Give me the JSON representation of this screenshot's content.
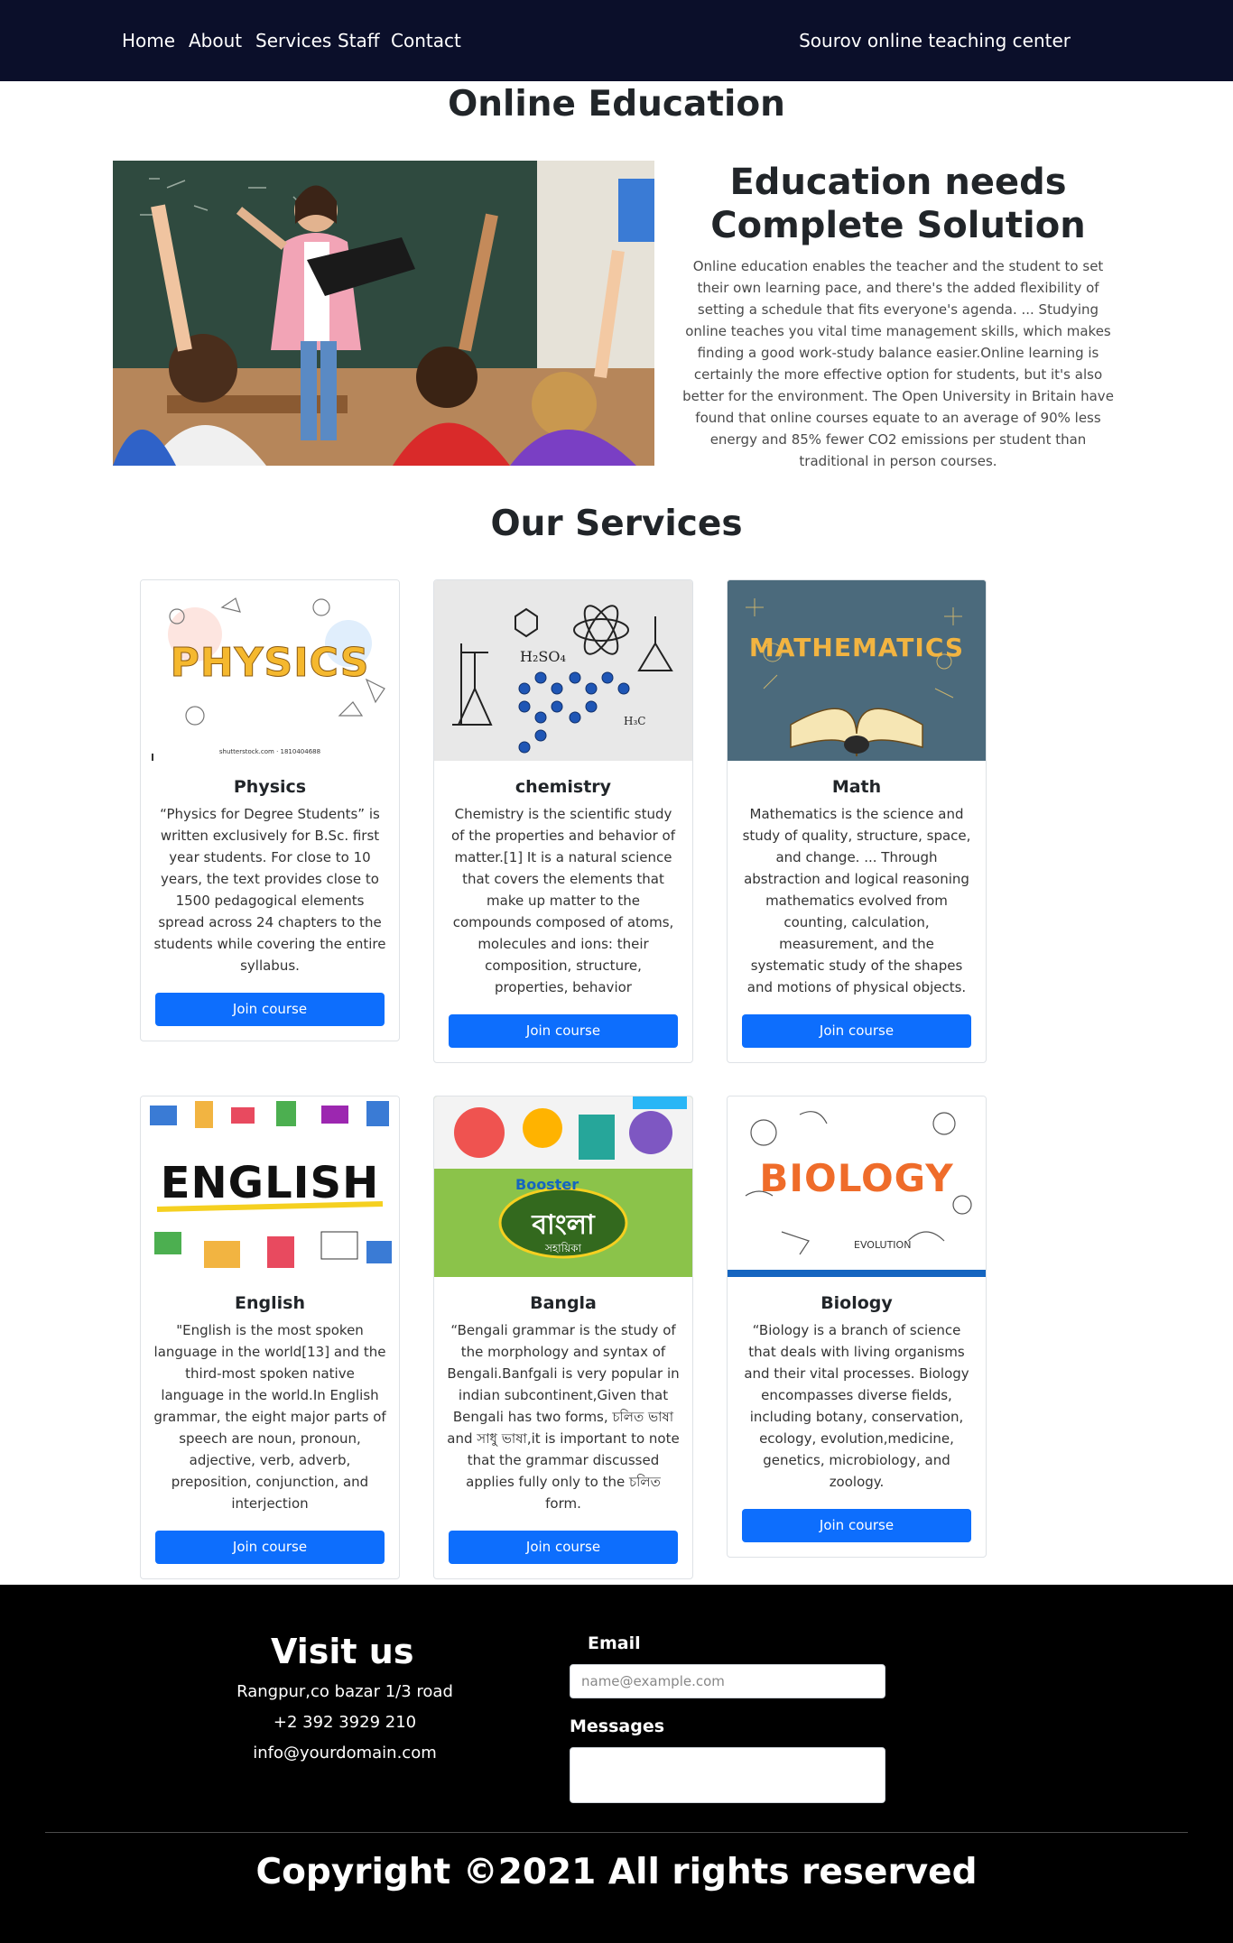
{
  "nav": {
    "links": [
      "Home",
      "About",
      "Services",
      "Staff",
      "Contact"
    ],
    "brand": "Sourov online teaching center"
  },
  "hero": {
    "title": "Online Education",
    "heading": "Education needs Complete Solution",
    "text": "Online education enables the teacher and the student to set their own learning pace, and there's the added flexibility of setting a schedule that fits everyone's agenda. ... Studying online teaches you vital time management skills, which makes finding a good work-study balance easier.Online learning is certainly the more effective option for students, but it's also better for the environment. The Open University in Britain have found that online courses equate to an average of 90% less energy and 85% fewer CO2 emissions per student than traditional in person courses."
  },
  "services": {
    "title": "Our Services",
    "button_label": "Join course",
    "cards": [
      {
        "title": "Physics",
        "image_label": "PHYSICS",
        "image_caption": "shutterstock.com · 1810404688",
        "text": "“Physics for Degree Students” is written exclusively for B.Sc. first year students. For close to 10 years, the text provides close to 1500 pedagogical elements spread across 24 chapters to the students while covering the entire syllabus."
      },
      {
        "title": "chemistry",
        "image_label": "",
        "text": "Chemistry is the scientific study of the properties and behavior of matter.[1] It is a natural science that covers the elements that make up matter to the compounds composed of atoms, molecules and ions: their composition, structure, properties, behavior"
      },
      {
        "title": "Math",
        "image_label": "MATHEMATICS",
        "text": "Mathematics is the science and study of quality, structure, space, and change. ... Through abstraction and logical reasoning mathematics evolved from counting, calculation, measurement, and the systematic study of the shapes and motions of physical objects."
      },
      {
        "title": "English",
        "image_label": "ENGLISH",
        "text": "\"English is the most spoken language in the world[13] and the third-most spoken native language in the world.In English grammar, the eight major parts of speech are noun, pronoun, adjective, verb, adverb, preposition, conjunction, and interjection"
      },
      {
        "title": "Bangla",
        "image_label": "বাংলা",
        "image_sub": "সহায়িকা",
        "image_tag": "Booster",
        "text": "“Bengali grammar is the study of the morphology and syntax of Bengali.Banfgali is very popular in indian subcontinent,Given that Bengali has two forms, চলিত ভাষা and সাধু ভাষা,it is important to note that the grammar discussed applies fully only to the চলিত form."
      },
      {
        "title": "Biology",
        "image_label": "BIOLOGY",
        "image_sub": "EVOLUTION",
        "text": "“Biology is a branch of science that deals with living organisms and their vital processes. Biology encompasses diverse fields, including botany, conservation, ecology, evolution,medicine, genetics, microbiology, and zoology."
      }
    ]
  },
  "footer": {
    "visit_title": "Visit us",
    "address": "Rangpur,co bazar 1/3 road",
    "phone": "+2 392 3929 210",
    "email": "info@yourdomain.com",
    "email_label": "Email",
    "email_placeholder": "name@example.com",
    "messages_label": "Messages",
    "copyright": "Copyright ©2021 All rights reserved"
  },
  "colors": {
    "navbar": "#0b0f2a",
    "button": "#0d6efd",
    "footer": "#000000"
  }
}
